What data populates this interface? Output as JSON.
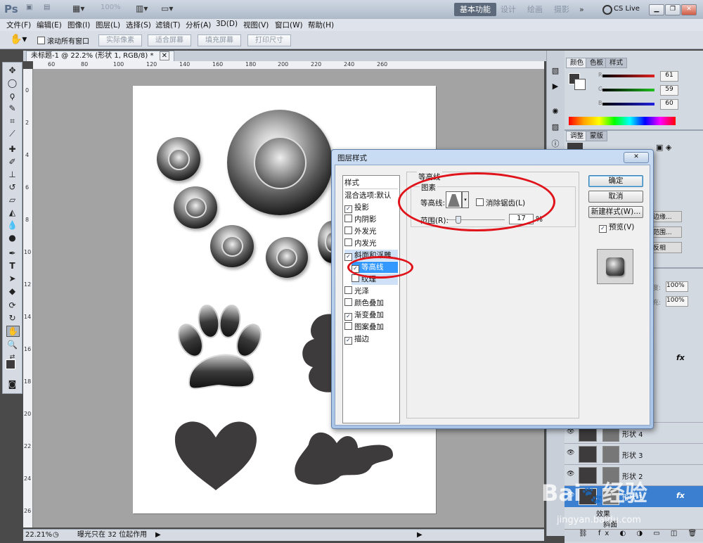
{
  "appbar": {
    "logo": "Ps",
    "zoom": "100%",
    "workspaces": [
      "基本功能",
      "设计",
      "绘画",
      "摄影"
    ],
    "more": "»",
    "cslive": "CS Live"
  },
  "menubar": [
    "文件(F)",
    "编辑(E)",
    "图像(I)",
    "图层(L)",
    "选择(S)",
    "滤镜(T)",
    "分析(A)",
    "3D(D)",
    "视图(V)",
    "窗口(W)",
    "帮助(H)"
  ],
  "options": {
    "scroll_all": "滚动所有窗口",
    "buttons": [
      "实际像素",
      "适合屏幕",
      "填充屏幕",
      "打印尺寸"
    ]
  },
  "document": {
    "tab_title": "未标题-1 @ 22.2% (形状 1, RGB/8) *",
    "ruler_h": [
      "60",
      "80",
      "100",
      "120",
      "140",
      "160",
      "180",
      "200",
      "220",
      "240",
      "260"
    ],
    "ruler_v": [
      "0",
      "2",
      "4",
      "6",
      "8",
      "10",
      "12",
      "14",
      "16",
      "18",
      "20",
      "22",
      "24",
      "26"
    ]
  },
  "status": {
    "zoom": "22.21%",
    "text": "曝光只在 32 位起作用"
  },
  "panels": {
    "color_tabs": [
      "颜色",
      "色板",
      "样式"
    ],
    "rgb": [
      {
        "label": "R",
        "value": "61",
        "color": "#e02020"
      },
      {
        "label": "G",
        "value": "59",
        "color": "#20c020"
      },
      {
        "label": "B",
        "value": "60",
        "color": "#2020e0"
      }
    ],
    "adj_tabs": [
      "调整",
      "蒙版"
    ],
    "adj_fragments": [
      "边缘...",
      "范围...",
      "反相"
    ],
    "opacity_label": "度:",
    "opacity": "100%",
    "fill_label": "充:",
    "fill": "100%",
    "fx": "fx",
    "layers": [
      {
        "name": "形状 4"
      },
      {
        "name": "形状 3"
      },
      {
        "name": "形状 2"
      },
      {
        "name": "形状 1"
      }
    ],
    "effects_label": "效果",
    "emboss_fragment": "斜面"
  },
  "dialog": {
    "title": "图层样式",
    "close": "✕",
    "styles_header": "样式",
    "blend_options": "混合选项:默认",
    "items": [
      {
        "label": "投影",
        "checked": true
      },
      {
        "label": "内阴影",
        "checked": false
      },
      {
        "label": "外发光",
        "checked": false
      },
      {
        "label": "内发光",
        "checked": false
      },
      {
        "label": "斜面和浮雕",
        "checked": true
      },
      {
        "label": "等高线",
        "checked": true
      },
      {
        "label": "纹理",
        "checked": false
      },
      {
        "label": "光泽",
        "checked": false
      },
      {
        "label": "颜色叠加",
        "checked": false
      },
      {
        "label": "渐变叠加",
        "checked": true
      },
      {
        "label": "图案叠加",
        "checked": false
      },
      {
        "label": "描边",
        "checked": true
      }
    ],
    "group_title": "等高线",
    "sub_title": "图素",
    "contour_label": "等高线:",
    "antialias_label": "消除锯齿(L)",
    "range_label": "范围(R):",
    "range_value": "17",
    "range_unit": "%",
    "range_fraction": 0.17,
    "ok": "确定",
    "cancel": "取消",
    "new_style": "新建样式(W)...",
    "preview_label": "预览(V)"
  },
  "watermark": {
    "brand": "Bai",
    "brand2": "经验",
    "url": "jingyan.baidu.com"
  }
}
